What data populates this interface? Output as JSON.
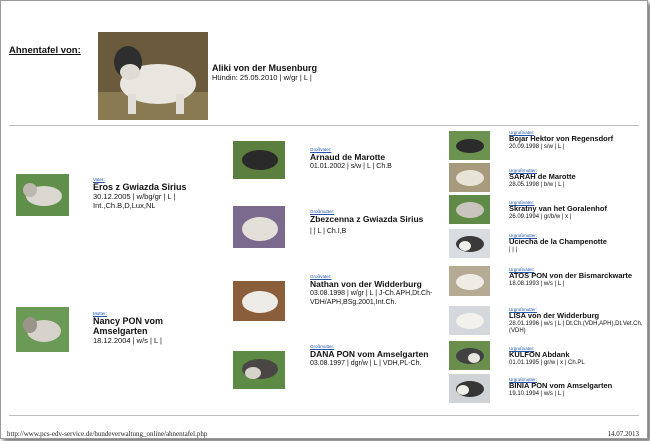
{
  "header": {
    "label": "Ahnentafel von:",
    "dog_name": "Aliki von der Musenburg",
    "dog_info": "Hündin: 25.05.2010 | w/gr | L |"
  },
  "parents": [
    {
      "relation": "Vater:",
      "name": "Eros z Gwiazda Sirius",
      "info": "30.12.2005 | w/bg/gr | L | Int.,Ch.B,D,Lux,NL"
    },
    {
      "relation": "Mutter:",
      "name": "Nancy PON vom Amselgarten",
      "info": "18.12.2004 | w/s | L |"
    }
  ],
  "grandparents": [
    {
      "relation": "Großvater:",
      "name": "Arnaud de Marotte",
      "info": "01.01.2002 | s/w | L | Ch.B"
    },
    {
      "relation": "Großmutter:",
      "name": "Zbezcenna z Gwiazda Sirius",
      "info": "| | L | Ch.I,B"
    },
    {
      "relation": "Großvater:",
      "name": "Nathan von der Widderburg",
      "info": "03.08.1998 | w/gr | L | J-Ch.APH,Dt.Ch-VDH/APH,BSg.2001,Int.Ch."
    },
    {
      "relation": "Großmutter:",
      "name": "DANA PON vom Amselgarten",
      "info": "03.08.1997 | dgr/w | L | VDH,PL-Ch."
    }
  ],
  "great_grandparents": [
    {
      "relation": "Urgroßvater:",
      "name": "Bojar Hektor von Regensdorf",
      "info": "20.09.1998 | s/w | L |"
    },
    {
      "relation": "Urgroßmutter:",
      "name": "SARAH de Marotte",
      "info": "28.05.1998 | b/w | L |"
    },
    {
      "relation": "Urgroßvater:",
      "name": "Skratny van het Goralenhof",
      "info": "26.09.1994 | gr/b/w | x |"
    },
    {
      "relation": "Urgroßmutter:",
      "name": "Uciecha de la Champenotte",
      "info": "| | |"
    },
    {
      "relation": "Urgroßvater:",
      "name": "ATOS PON von der Bismarckwarte",
      "info": "18.08.1993 | w/s | L |"
    },
    {
      "relation": "Urgroßmutter:",
      "name": "LISA von der Widderburg",
      "info": "28.01.1996 | w/s | L | Dt.Ch.(VDH,APH),Dt.Vet.Ch.(VDH)"
    },
    {
      "relation": "Urgroßvater:",
      "name": "KULFON Abdank",
      "info": "01.01.1995 | gr/w | x | Ch.PL"
    },
    {
      "relation": "Urgroßmutter:",
      "name": "BINIA PON vom Amselgarten",
      "info": "19.10.1994 | w/s | L |"
    }
  ],
  "footer": {
    "url": "http://www.pcs-edv-service.de/hundeverwaltung_online/ahnentafel.php",
    "date": "14.07.2013"
  },
  "colors": {
    "link": "#2255aa",
    "rule": "#bdbdbd",
    "frame": "#9a9a9a"
  }
}
